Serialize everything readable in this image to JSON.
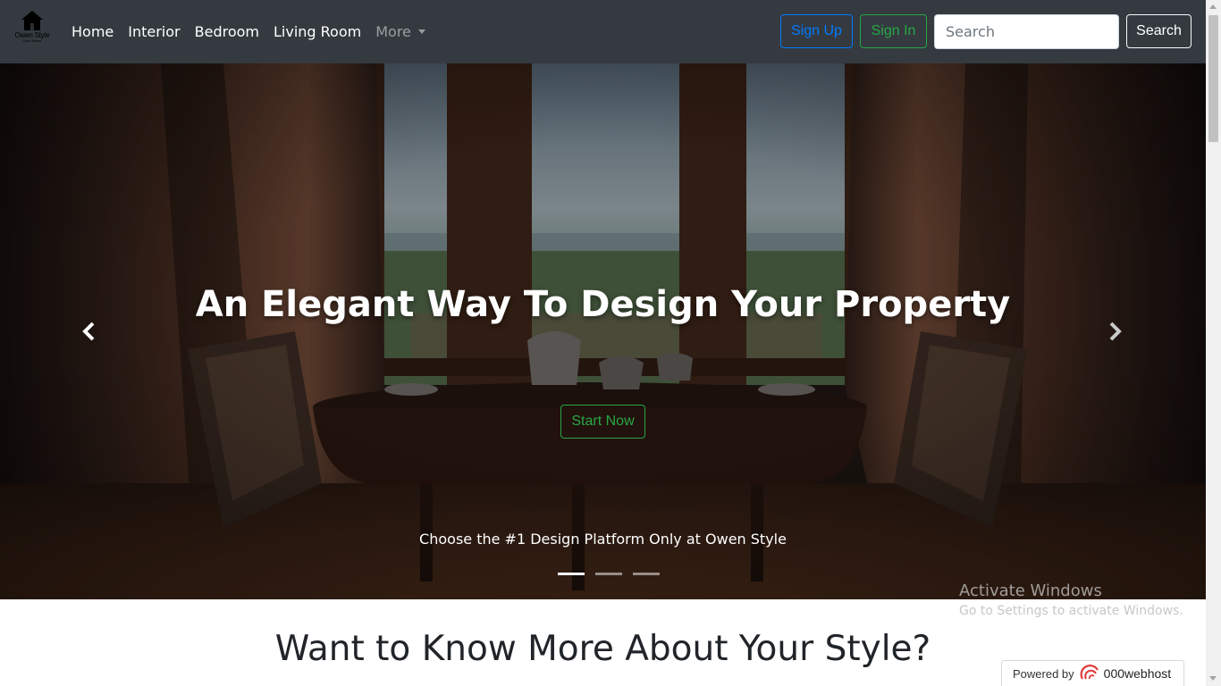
{
  "brand": {
    "name": "Owen Style",
    "tagline": "Own Sense"
  },
  "nav": {
    "links": [
      "Home",
      "Interior",
      "Bedroom",
      "Living Room"
    ],
    "more_label": "More"
  },
  "auth": {
    "signup_label": "Sign Up",
    "signin_label": "Sign In"
  },
  "search": {
    "placeholder": "Search",
    "button_label": "Search"
  },
  "hero": {
    "title": "An Elegant Way To Design Your Property",
    "cta_label": "Start Now",
    "caption": "Choose the #1 Design Platform Only at Owen Style",
    "slide_count": 3,
    "active_slide": 1,
    "prev_icon": "chevron-left-icon",
    "next_icon": "chevron-right-icon"
  },
  "section": {
    "title": "Want to Know More About Your Style?"
  },
  "watermark": {
    "line1": "Activate Windows",
    "line2": "Go to Settings to activate Windows."
  },
  "badge": {
    "prefix": "Powered by",
    "brand": "000webhost"
  },
  "colors": {
    "navbar_bg": "#343a40",
    "primary": "#007bff",
    "success": "#28a745"
  }
}
